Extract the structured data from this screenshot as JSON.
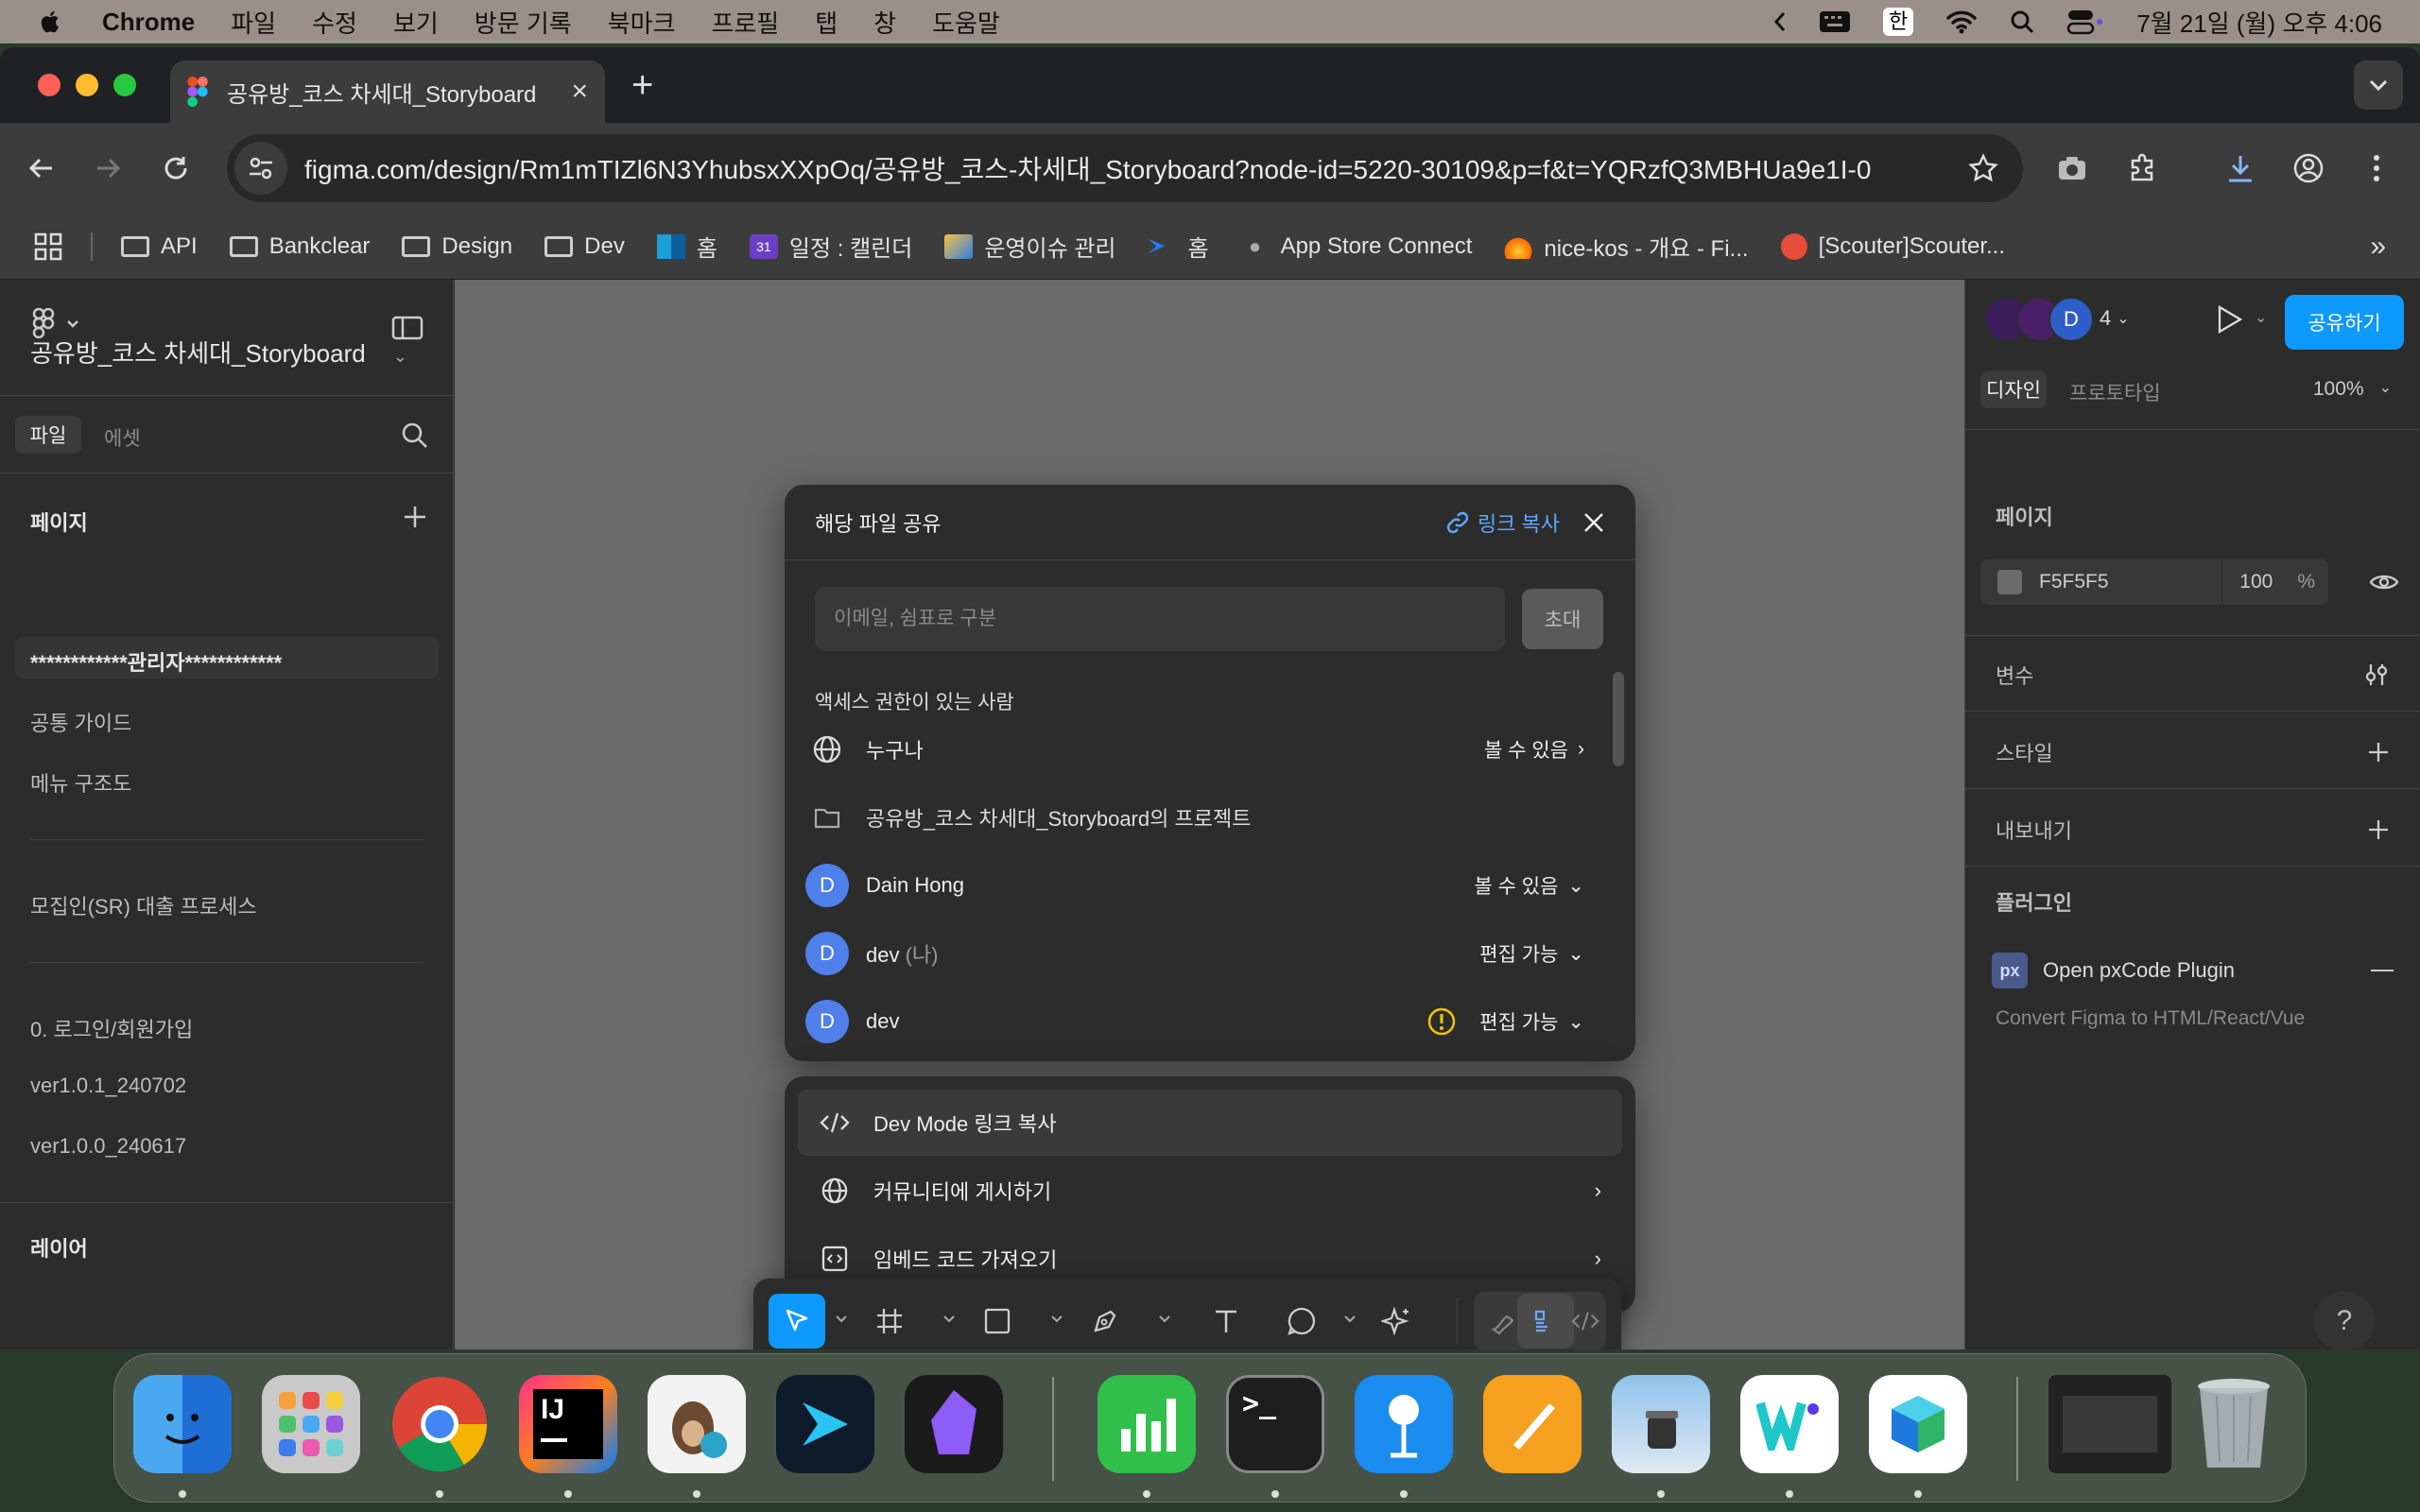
{
  "menubar": {
    "app": "Chrome",
    "items": [
      "파일",
      "수정",
      "보기",
      "방문 기록",
      "북마크",
      "프로필",
      "탭",
      "창",
      "도움말"
    ],
    "input_method": "한",
    "datetime": "7월 21일 (월) 오후 4:06"
  },
  "browser": {
    "tab_title": "공유방_코스 차세대_Storyboard",
    "url": "figma.com/design/Rm1mTIZl6N3YhubsxXXpOq/공유방_코스-차세대_Storyboard?node-id=5220-30109&p=f&t=YQRzfQ3MBHUa9e1I-0",
    "bookmarks": [
      {
        "label": "API",
        "icon": "folder-icon"
      },
      {
        "label": "Bankclear",
        "icon": "folder-icon"
      },
      {
        "label": "Design",
        "icon": "folder-icon"
      },
      {
        "label": "Dev",
        "icon": "folder-icon"
      },
      {
        "label": "홈",
        "icon": "app-icon"
      },
      {
        "label": "일정 : 캘린더",
        "icon": "calendar-icon"
      },
      {
        "label": "운영이슈 관리",
        "icon": "app-icon"
      },
      {
        "label": "홈",
        "icon": "app-icon"
      },
      {
        "label": "App Store Connect",
        "icon": "apple-icon"
      },
      {
        "label": "nice-kos - 개요 - Fi...",
        "icon": "fire-icon"
      },
      {
        "label": "[Scouter]Scouter...",
        "icon": "scouter-icon"
      }
    ]
  },
  "left_panel": {
    "file_name": "공유방_코스 차세대_Storyboard",
    "tab_file": "파일",
    "tab_assets": "에셋",
    "pages_title": "페이지",
    "pages": [
      "************관리자************",
      "공통 가이드",
      "메뉴 구조도",
      "모집인(SR) 대출 프로세스",
      "0. 로그인/회원가입",
      "ver1.0.1_240702",
      "ver1.0.0_240617"
    ],
    "layers_title": "레이어"
  },
  "right_panel": {
    "user_count": "4",
    "avatar_letter": "D",
    "share_button": "공유하기",
    "tab_design": "디자인",
    "tab_prototype": "프로토타입",
    "zoom": "100%",
    "page_title": "페이지",
    "page_color": "F5F5F5",
    "page_opacity": "100",
    "page_opacity_unit": "%",
    "variables": "변수",
    "styles": "스타일",
    "export": "내보내기",
    "plugins": "플러그인",
    "plugin_name": "Open pxCode Plugin",
    "plugin_desc": "Convert Figma to HTML/React/Vue",
    "plugin_badge": "px"
  },
  "share_dialog": {
    "title": "해당 파일 공유",
    "copy_link": "링크 복사",
    "invite_placeholder": "이메일, 쉼표로 구분",
    "invite_button": "초대",
    "access_title": "액세스 권한이 있는 사람",
    "rows": [
      {
        "name": "누구나",
        "perm": "볼 수 있음",
        "icon": "globe-icon"
      },
      {
        "name": "공유방_코스 차세대_Storyboard의 프로젝트",
        "perm": "",
        "icon": "folder-icon"
      },
      {
        "name": "Dain Hong",
        "perm": "볼 수 있음",
        "avatar": "D"
      },
      {
        "name": "dev",
        "suffix": "(나)",
        "perm": "편집 가능",
        "avatar": "D"
      },
      {
        "name": "dev",
        "perm": "편집 가능",
        "avatar": "D"
      }
    ]
  },
  "share_menu": [
    {
      "label": "Dev Mode 링크 복사",
      "icon": "code-icon"
    },
    {
      "label": "커뮤니티에 게시하기",
      "icon": "globe-icon"
    },
    {
      "label": "임베드 코드 가져오기",
      "icon": "embed-icon"
    }
  ],
  "help": "?",
  "colors": {
    "accent": "#0d99ff",
    "link": "#5fa8ff",
    "avatar": "#4f7fe8",
    "canvas": "#6b6b6b"
  }
}
